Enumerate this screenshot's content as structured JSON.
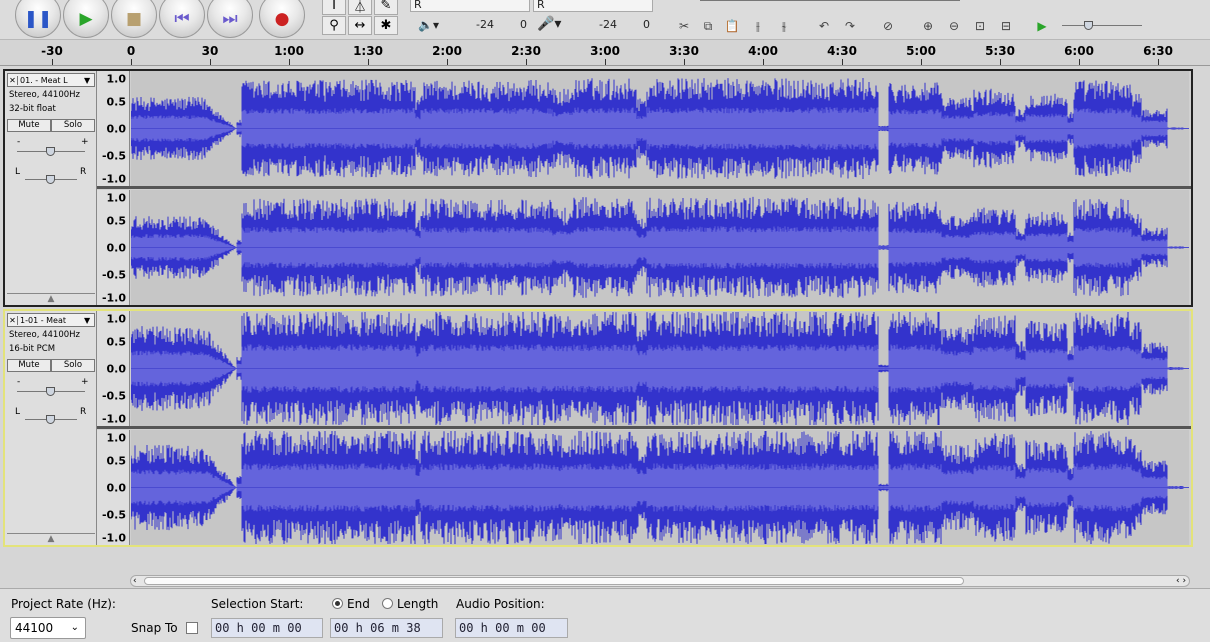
{
  "toolbar": {
    "transport": [
      {
        "name": "pause-button",
        "icon": "pause-icon",
        "glyph": "❚❚",
        "color": "#2b56c7"
      },
      {
        "name": "play-button",
        "icon": "play-icon",
        "glyph": "▶",
        "color": "#2aa52a"
      },
      {
        "name": "stop-button",
        "icon": "stop-icon",
        "glyph": "■",
        "color": "#b8a070"
      },
      {
        "name": "skip-start-button",
        "icon": "skip-to-start-icon",
        "glyph": "⏮",
        "color": "#6a5acd"
      },
      {
        "name": "skip-end-button",
        "icon": "skip-to-end-icon",
        "glyph": "⏭",
        "color": "#6a5acd"
      },
      {
        "name": "record-button",
        "icon": "record-icon",
        "glyph": "●",
        "color": "#cc2222"
      }
    ],
    "tools": {
      "selection": "I",
      "envelope": "⏃",
      "draw": "✎",
      "zoom": "⚲",
      "timeshift": "↔",
      "multi": "✱"
    },
    "meter": {
      "playback_channel": "R",
      "record_channel": "R",
      "play_db": "-24",
      "play_zero": "0",
      "rec_db": "-24",
      "rec_zero": "0"
    }
  },
  "ruler": {
    "labels": [
      "-30",
      "0",
      "30",
      "1:00",
      "1:30",
      "2:00",
      "2:30",
      "3:00",
      "3:30",
      "4:00",
      "4:30",
      "5:00",
      "5:30",
      "6:00",
      "6:30"
    ]
  },
  "tracks": [
    {
      "name": "01. - Meat L",
      "info1": "Stereo, 44100Hz",
      "info2": "32-bit float",
      "mute": "Mute",
      "solo": "Solo",
      "pan_l": "L",
      "pan_r": "R",
      "gain_minus": "-",
      "gain_plus": "+",
      "selected": false
    },
    {
      "name": "1-01 - Meat",
      "info1": "Stereo, 44100Hz",
      "info2": "16-bit PCM",
      "mute": "Mute",
      "solo": "Solo",
      "pan_l": "L",
      "pan_r": "R",
      "gain_minus": "-",
      "gain_plus": "+",
      "selected": true
    }
  ],
  "vruler": {
    "labels": [
      "1.0",
      "0.5",
      "0.0",
      "-0.5",
      "-1.0"
    ]
  },
  "selection_bar": {
    "project_rate_label": "Project Rate (Hz):",
    "project_rate_value": "44100",
    "snap_to_label": "Snap To",
    "selection_start_label": "Selection Start:",
    "end_label": "End",
    "length_label": "Length",
    "audio_position_label": "Audio Position:",
    "selection_start": "00 h 00 m 00 s",
    "selection_end": "00 h 06 m 38 s",
    "audio_position": "00 h 00 m 00 s"
  },
  "colors": {
    "wave": "#3333cc",
    "wave_rms": "#6464dc",
    "track_bg": "#c8c8c8",
    "selected_border": "#e3e37a"
  }
}
